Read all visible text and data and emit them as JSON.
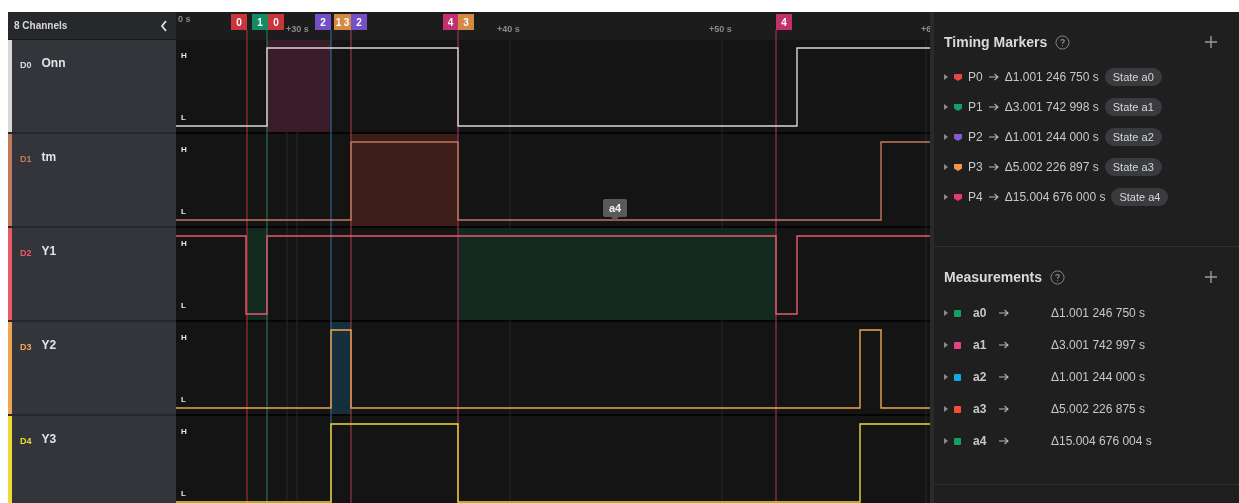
{
  "sidebar": {
    "title": "8 Channels"
  },
  "channels": [
    {
      "id": "D0",
      "name": "Onn",
      "color": "#d8d8d8",
      "high_label": "H",
      "low_label": "L"
    },
    {
      "id": "D1",
      "name": "tm",
      "color": "#c27a5e",
      "high_label": "H",
      "low_label": "L"
    },
    {
      "id": "D2",
      "name": "Y1",
      "color": "#ea5a6c",
      "high_label": "H",
      "low_label": "L"
    },
    {
      "id": "D3",
      "name": "Y2",
      "color": "#f0a550",
      "high_label": "H",
      "low_label": "L"
    },
    {
      "id": "D4",
      "name": "Y3",
      "color": "#f0d838",
      "high_label": "H",
      "low_label": "L"
    }
  ],
  "time_axis": [
    "0 s",
    "+30 s",
    "+40 s",
    "+50 s",
    "+6"
  ],
  "marker_flags": [
    {
      "label": "0",
      "color": "#c8363c"
    },
    {
      "label": "1",
      "color": "#128a62"
    },
    {
      "label": "0",
      "color": "#c8363c"
    },
    {
      "label": "2",
      "color": "#7450c4"
    },
    {
      "label": "1",
      "color": "#d48a42"
    },
    {
      "label": "3",
      "color": "#d48a42"
    },
    {
      "label": "2",
      "color": "#7450c4"
    },
    {
      "label": "4",
      "color": "#c2306e"
    },
    {
      "label": "3",
      "color": "#d48a42"
    },
    {
      "label": "4",
      "color": "#c2306e"
    }
  ],
  "tooltip": {
    "text": "a4"
  },
  "timing_markers": {
    "title": "Timing Markers",
    "items": [
      {
        "name": "P0",
        "delta": "Δ1.001 246 750 s",
        "state": "State a0",
        "color": "#e84444"
      },
      {
        "name": "P1",
        "delta": "Δ3.001 742 998 s",
        "state": "State a1",
        "color": "#12a070"
      },
      {
        "name": "P2",
        "delta": "Δ1.001 244 000 s",
        "state": "State a2",
        "color": "#8a56d8"
      },
      {
        "name": "P3",
        "delta": "Δ5.002 226 897 s",
        "state": "State a3",
        "color": "#f49444"
      },
      {
        "name": "P4",
        "delta": "Δ15.004 676 000 s",
        "state": "State a4",
        "color": "#e6367a"
      }
    ]
  },
  "measurements": {
    "title": "Measurements",
    "items": [
      {
        "name": "a0",
        "delta": "Δ1.001 246 750 s",
        "color": "#10a060"
      },
      {
        "name": "a1",
        "delta": "Δ3.001 742 997 s",
        "color": "#e64088"
      },
      {
        "name": "a2",
        "delta": "Δ1.001 244 000 s",
        "color": "#12a8e0"
      },
      {
        "name": "a3",
        "delta": "Δ5.002 226 875 s",
        "color": "#f24e32"
      },
      {
        "name": "a4",
        "delta": "Δ15.004 676 004 s",
        "color": "#10a060"
      }
    ]
  }
}
